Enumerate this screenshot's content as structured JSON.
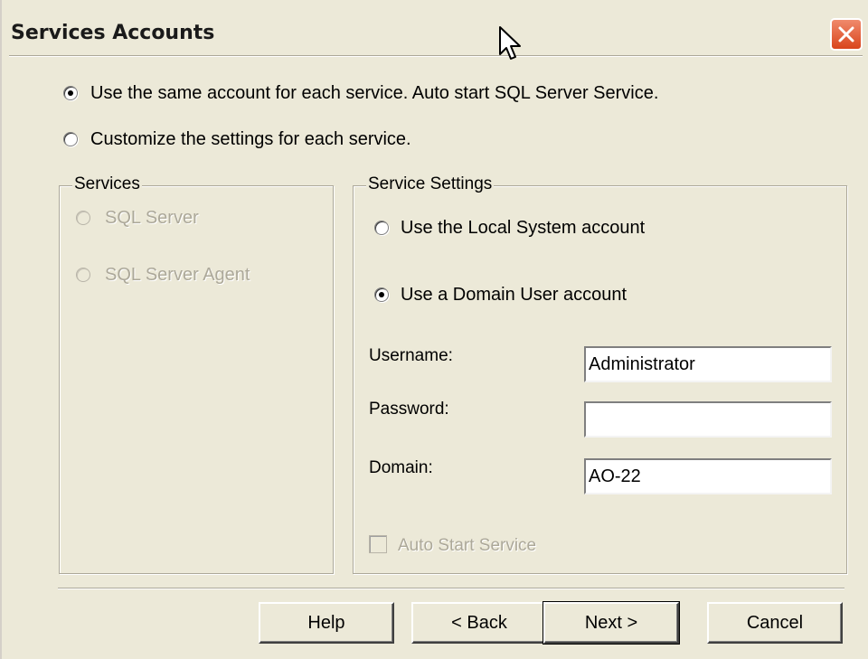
{
  "window": {
    "title": "Services Accounts"
  },
  "account_mode": {
    "same_account_label": "Use the same account for each service. Auto start SQL Server Service.",
    "customize_label": "Customize the settings for each service."
  },
  "services_group": {
    "title": "Services",
    "items": [
      {
        "label": "SQL Server"
      },
      {
        "label": "SQL Server Agent"
      }
    ]
  },
  "service_settings": {
    "title": "Service Settings",
    "local_system_label": "Use the Local System account",
    "domain_user_label": "Use a Domain User account",
    "username_label": "Username:",
    "username_value": "Administrator",
    "password_label": "Password:",
    "password_value": "",
    "domain_label": "Domain:",
    "domain_value": "AO-22",
    "auto_start_label": "Auto Start Service"
  },
  "buttons": {
    "help": "Help",
    "back": "< Back",
    "next": "Next >",
    "cancel": "Cancel"
  },
  "colors": {
    "dialog_bg": "#ece9d8",
    "close_button": "#d9441c",
    "disabled_text": "#aca899"
  }
}
